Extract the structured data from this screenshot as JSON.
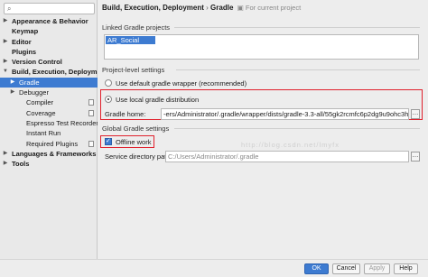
{
  "sidebar": {
    "search_placeholder": "",
    "items": [
      {
        "label": "Appearance & Behavior",
        "arrow": "▶",
        "bold": true,
        "level": 0
      },
      {
        "label": "Keymap",
        "arrow": "",
        "bold": true,
        "level": 0
      },
      {
        "label": "Editor",
        "arrow": "▶",
        "bold": true,
        "level": 0
      },
      {
        "label": "Plugins",
        "arrow": "",
        "bold": true,
        "level": 0
      },
      {
        "label": "Version Control",
        "arrow": "▶",
        "bold": true,
        "level": 0
      },
      {
        "label": "Build, Execution, Deployment",
        "arrow": "▼",
        "bold": true,
        "level": 0
      },
      {
        "label": "Gradle",
        "arrow": "▶",
        "bold": false,
        "level": 1,
        "selected": true
      },
      {
        "label": "Debugger",
        "arrow": "▶",
        "bold": false,
        "level": 1
      },
      {
        "label": "Compiler",
        "arrow": "",
        "bold": false,
        "level": 2,
        "doc": true
      },
      {
        "label": "Coverage",
        "arrow": "",
        "bold": false,
        "level": 2,
        "doc": true
      },
      {
        "label": "Espresso Test Recorder",
        "arrow": "",
        "bold": false,
        "level": 2
      },
      {
        "label": "Instant Run",
        "arrow": "",
        "bold": false,
        "level": 2
      },
      {
        "label": "Required Plugins",
        "arrow": "",
        "bold": false,
        "level": 2,
        "doc": true
      },
      {
        "label": "Languages & Frameworks",
        "arrow": "▶",
        "bold": true,
        "level": 0
      },
      {
        "label": "Tools",
        "arrow": "▶",
        "bold": true,
        "level": 0
      }
    ]
  },
  "breadcrumb": {
    "part1": "Build, Execution, Deployment",
    "separator": "›",
    "part2": "Gradle",
    "note": "For current project"
  },
  "linked": {
    "title": "Linked Gradle projects",
    "items": [
      "AR_Social"
    ]
  },
  "project_level": {
    "title": "Project-level settings",
    "option_default": "Use default gradle wrapper (recommended)",
    "option_local": "Use local gradle distribution",
    "gradle_home_label": "Gradle home:",
    "gradle_home_value": "-ers/Administrator/.gradle/wrapper/dists/gradle-3.3-all/55gk2rcmfc6p2dg9u9ohc3hw9/gradle-3.3"
  },
  "global": {
    "title": "Global Gradle settings",
    "offline_label": "Offline work",
    "service_dir_label": "Service directory path:",
    "service_dir_value": "C:/Users/Administrator/.gradle"
  },
  "watermark": "http://blog.csdn.net/lmyfx",
  "footer": {
    "ok": "OK",
    "cancel": "Cancel",
    "apply": "Apply",
    "help": "Help"
  },
  "colors": {
    "accent": "#3d7bd1",
    "highlight_border": "#e0202c"
  }
}
